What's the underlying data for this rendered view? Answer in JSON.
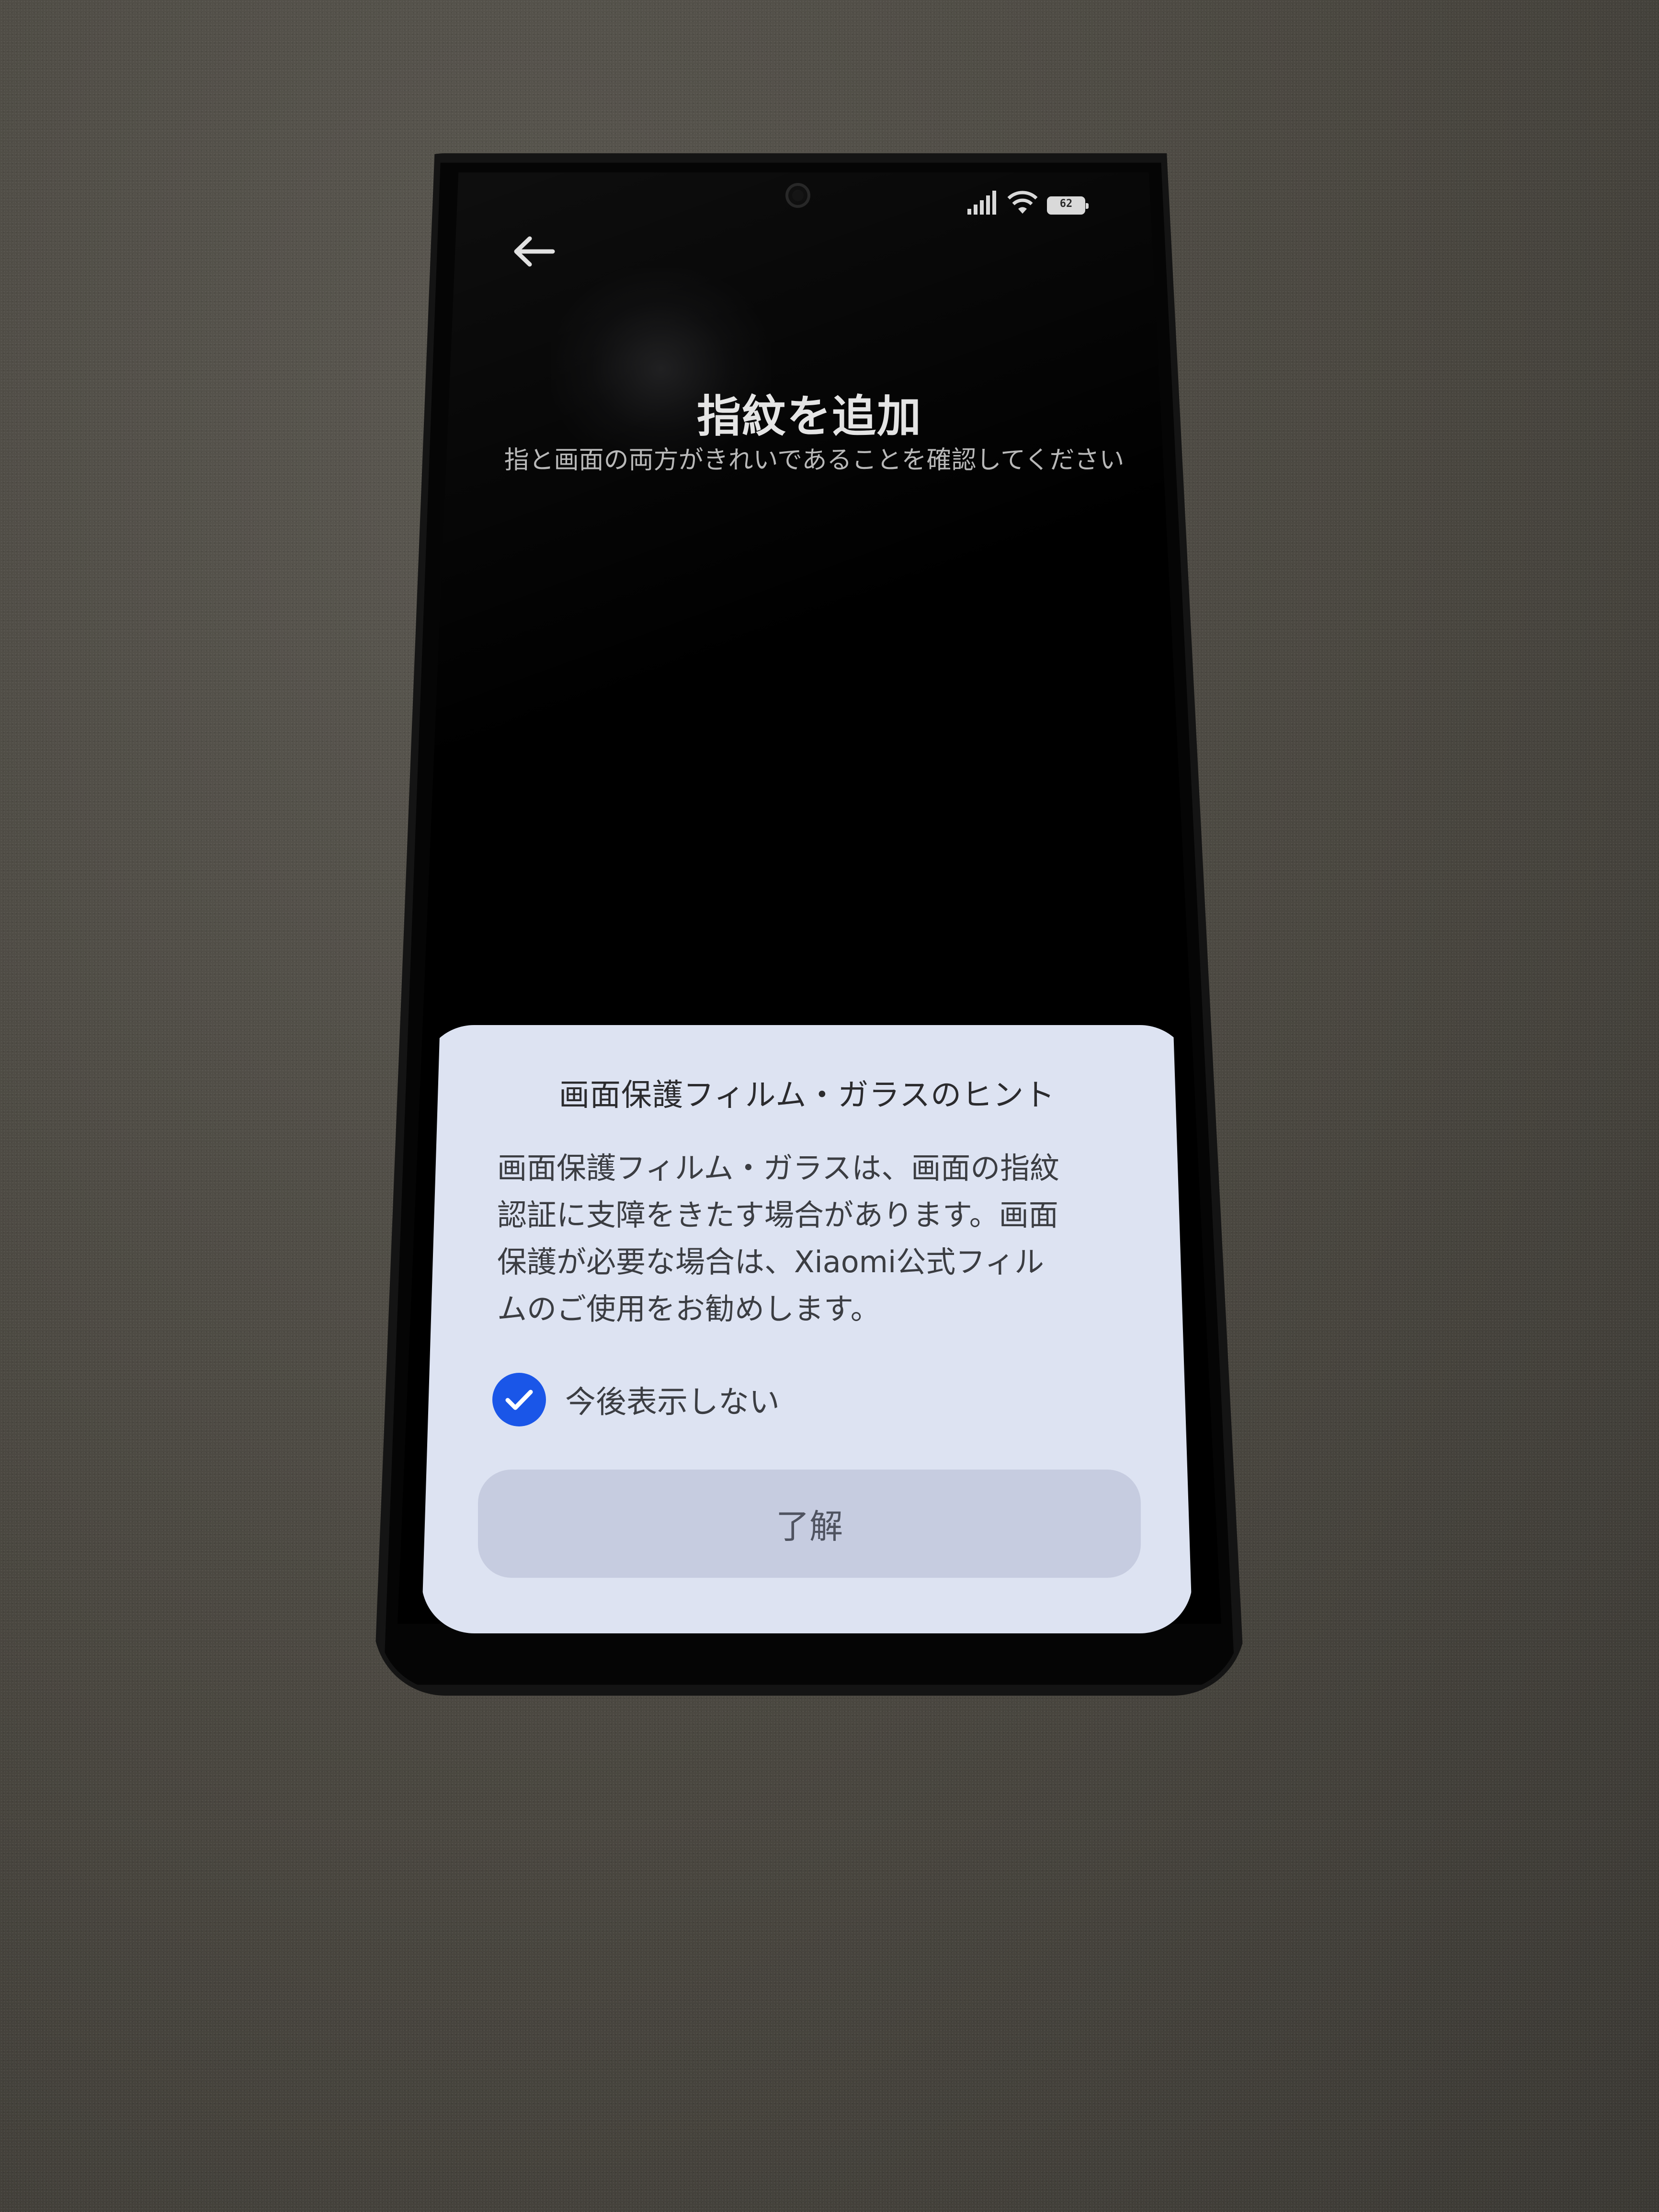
{
  "screen": {
    "title": "指紋を追加",
    "subtitle": "指と画面の両方がきれいであることを確認してください"
  },
  "status_bar": {
    "battery_level": "62",
    "icons": [
      "signal-icon",
      "wifi-icon",
      "battery-icon"
    ]
  },
  "navigation": {
    "back_icon": "back-arrow-icon"
  },
  "dialog": {
    "title": "画面保護フィルム・ガラスのヒント",
    "body_lines": [
      "画面保護フィルム・ガラスは、画面の指紋",
      "認証に支障をきたす場合があります。画面",
      "保護が必要な場合は、Xiaomi公式フィル",
      "ムのご使用をお勧めします。"
    ],
    "checkbox": {
      "label": "今後表示しない",
      "checked": true
    },
    "button_label": "了解"
  },
  "colors": {
    "dialog_background": "#dde3f2",
    "checkbox_accent": "#1a56e8",
    "button_background": "#c6cce0",
    "screen_background": "#000000"
  }
}
